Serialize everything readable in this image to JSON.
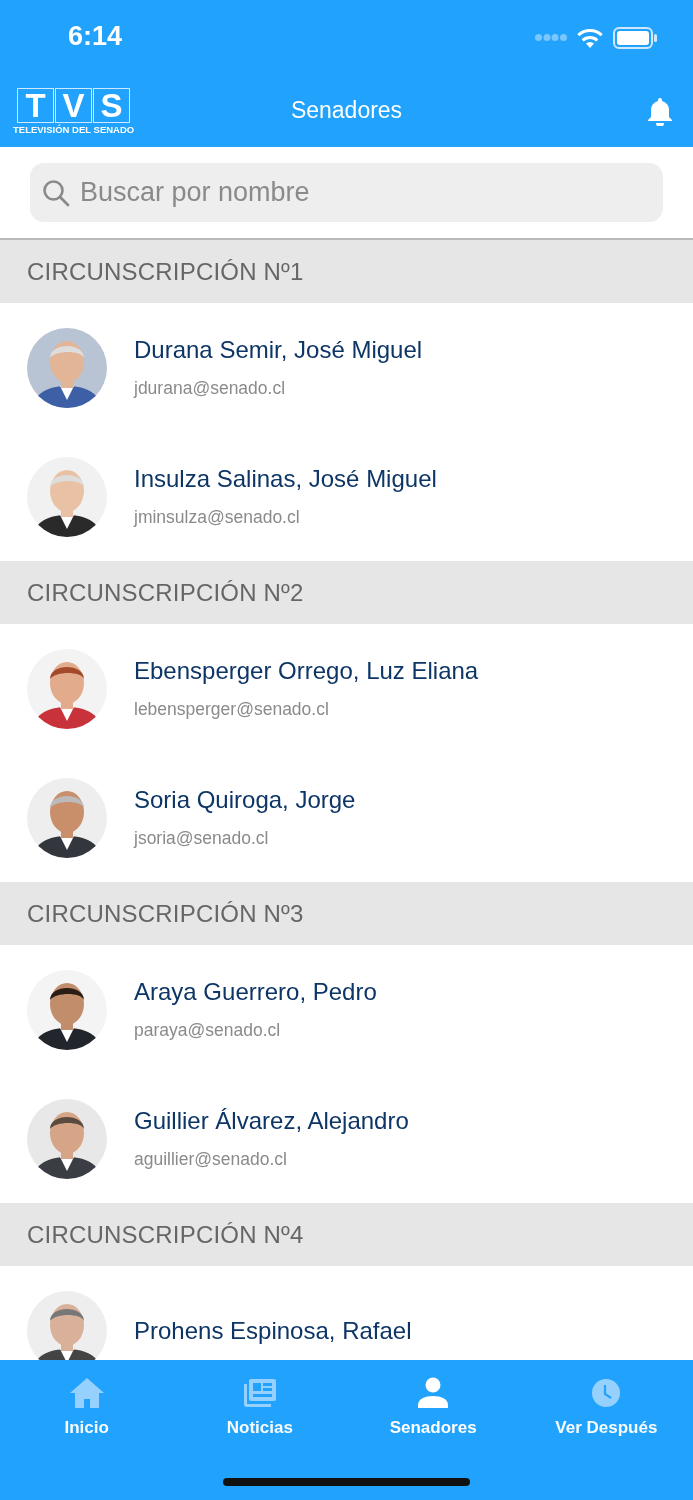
{
  "status_bar": {
    "time": "6:14"
  },
  "nav_bar": {
    "logo": {
      "letters": [
        "T",
        "V",
        "S"
      ],
      "caption": "TELEVISIÓN DEL SENADO"
    },
    "title": "Senadores"
  },
  "search": {
    "placeholder": "Buscar por nombre"
  },
  "sections": [
    {
      "title": "CIRCUNSCRIPCIÓN Nº1",
      "senators": [
        {
          "name": "Durana Semir, José Miguel",
          "email": "jdurana@senado.cl"
        },
        {
          "name": "Insulza Salinas, José Miguel",
          "email": "jminsulza@senado.cl"
        }
      ]
    },
    {
      "title": "CIRCUNSCRIPCIÓN Nº2",
      "senators": [
        {
          "name": "Ebensperger Orrego, Luz Eliana",
          "email": "lebensperger@senado.cl"
        },
        {
          "name": "Soria Quiroga, Jorge",
          "email": "jsoria@senado.cl"
        }
      ]
    },
    {
      "title": "CIRCUNSCRIPCIÓN Nº3",
      "senators": [
        {
          "name": "Araya Guerrero, Pedro",
          "email": "paraya@senado.cl"
        },
        {
          "name": "Guillier Álvarez, Alejandro",
          "email": "aguillier@senado.cl"
        }
      ]
    },
    {
      "title": "CIRCUNSCRIPCIÓN Nº4",
      "senators": [
        {
          "name": "Prohens Espinosa, Rafael"
        }
      ]
    }
  ],
  "tab_bar": [
    {
      "label": "Inicio",
      "kind": "home",
      "selected": false
    },
    {
      "label": "Noticias",
      "kind": "news",
      "selected": false
    },
    {
      "label": "Senadores",
      "kind": "person",
      "selected": true
    },
    {
      "label": "Ver Después",
      "kind": "clock",
      "selected": false
    }
  ]
}
